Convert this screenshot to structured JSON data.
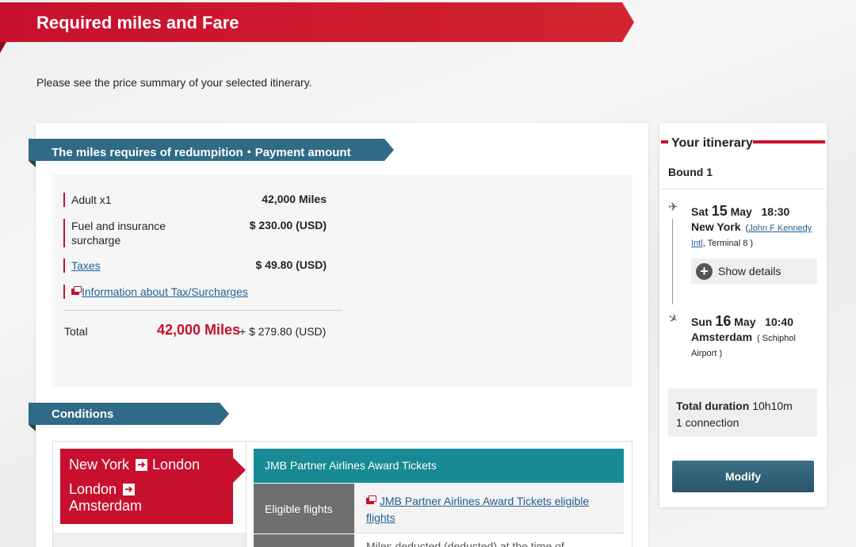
{
  "header": {
    "title": "Required miles and Fare"
  },
  "intro": "Please see the price summary of your selected itinerary.",
  "fare": {
    "section_title": "The miles requires of redumpition・Payment amount",
    "rows": [
      {
        "label": "Adult x1",
        "value": "42,000 Miles"
      },
      {
        "label": "Fuel and insurance surcharge",
        "value": "$ 230.00 (USD)"
      },
      {
        "label": "Taxes",
        "value": "$ 49.80 (USD)"
      }
    ],
    "tax_info_link": "Information about Tax/Surcharges",
    "total_label": "Total",
    "total_miles": "42,000 Miles",
    "total_plus": "+ $ 279.80 (USD)"
  },
  "conditions": {
    "section_title": "Conditions",
    "routes": [
      {
        "from": "New York",
        "to": "London"
      },
      {
        "from": "London",
        "to": "Amsterdam"
      }
    ],
    "award_heading": "JMB Partner Airlines Award Tickets",
    "eligible_label": "Eligible flights",
    "eligible_link": "JMB Partner Airlines Award Tickets eligible flights",
    "next_row_text": "Miles deducted (deducted) at the time of ..."
  },
  "itinerary": {
    "title": "Your itinerary",
    "bound": "Bound 1",
    "departure": {
      "weekday": "Sat",
      "day": "15",
      "month": "May",
      "time": "18:30",
      "city": "New York",
      "airport": "John F Kennedy Intl",
      "terminal": ", Terminal 8 )"
    },
    "show_details": "Show details",
    "arrival": {
      "weekday": "Sun",
      "day": "16",
      "month": "May",
      "time": "10:40",
      "city": "Amsterdam",
      "airport": "( Schiphol Airport )"
    },
    "duration_label": "Total duration",
    "duration_value": "10h10m",
    "connections": "1 connection",
    "modify_label": "Modify"
  },
  "colors": {
    "brand_red": "#c8102e",
    "tag_blue": "#2f6b86",
    "teal": "#178a94"
  },
  "icons": {
    "depart": "takeoff-icon",
    "arrive": "landing-icon",
    "arrow": "arrow-right-icon",
    "plus": "plus-circle-icon"
  }
}
